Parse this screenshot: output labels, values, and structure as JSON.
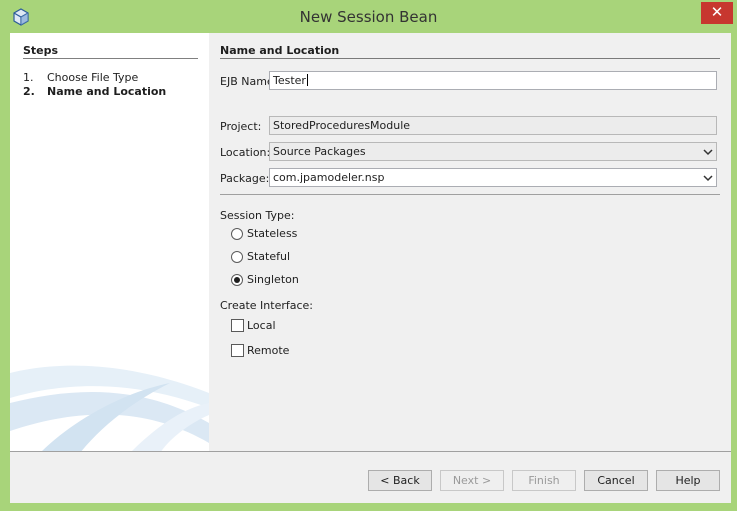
{
  "window": {
    "title": "New Session Bean",
    "close_glyph": "✕"
  },
  "steps": {
    "title": "Steps",
    "items": [
      {
        "num": "1.",
        "label": "Choose File Type"
      },
      {
        "num": "2.",
        "label": "Name and Location"
      }
    ]
  },
  "panel": {
    "title": "Name and Location",
    "ejb_name": {
      "label": "EJB Name:",
      "value": "Tester"
    },
    "project": {
      "label": "Project:",
      "value": "StoredProceduresModule"
    },
    "location": {
      "label": "Location:",
      "value": "Source Packages"
    },
    "package": {
      "label": "Package:",
      "value": "com.jpamodeler.nsp"
    },
    "session_type": {
      "label": "Session Type:",
      "options": [
        "Stateless",
        "Stateful",
        "Singleton"
      ],
      "selected": "Singleton"
    },
    "create_interface": {
      "label": "Create Interface:",
      "options": [
        {
          "label": "Local",
          "checked": false
        },
        {
          "label": "Remote",
          "checked": false
        }
      ]
    }
  },
  "buttons": {
    "back": "< Back",
    "next": "Next >",
    "finish": "Finish",
    "cancel": "Cancel",
    "help": "Help"
  },
  "icons": [
    "netbeans-cube-icon",
    "close-icon",
    "chevron-down-icon"
  ],
  "colors": {
    "frame": "#a8d47a",
    "close": "#c7372f",
    "dialog_bg": "#f0f0f0"
  }
}
